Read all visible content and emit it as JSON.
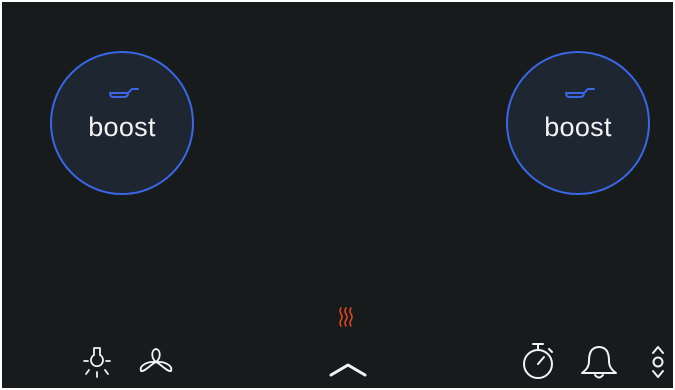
{
  "colors": {
    "background": "#171b1c",
    "zone_fill": "#1e2632",
    "zone_ring": "#3b66e6",
    "heat_indicator": "#e0461d",
    "icon": "#f2f2f2"
  },
  "zones": [
    {
      "id": "left",
      "label": "boost",
      "icon": "pan-icon"
    },
    {
      "id": "right",
      "label": "boost",
      "icon": "pan-icon"
    }
  ],
  "toolbar": {
    "left_icons": [
      "light-icon",
      "fan-icon"
    ],
    "center_icons": [
      "heat-indicator-icon",
      "chevron-up-icon"
    ],
    "right_icons": [
      "timer-icon",
      "bell-icon",
      "up-down-icon"
    ]
  }
}
